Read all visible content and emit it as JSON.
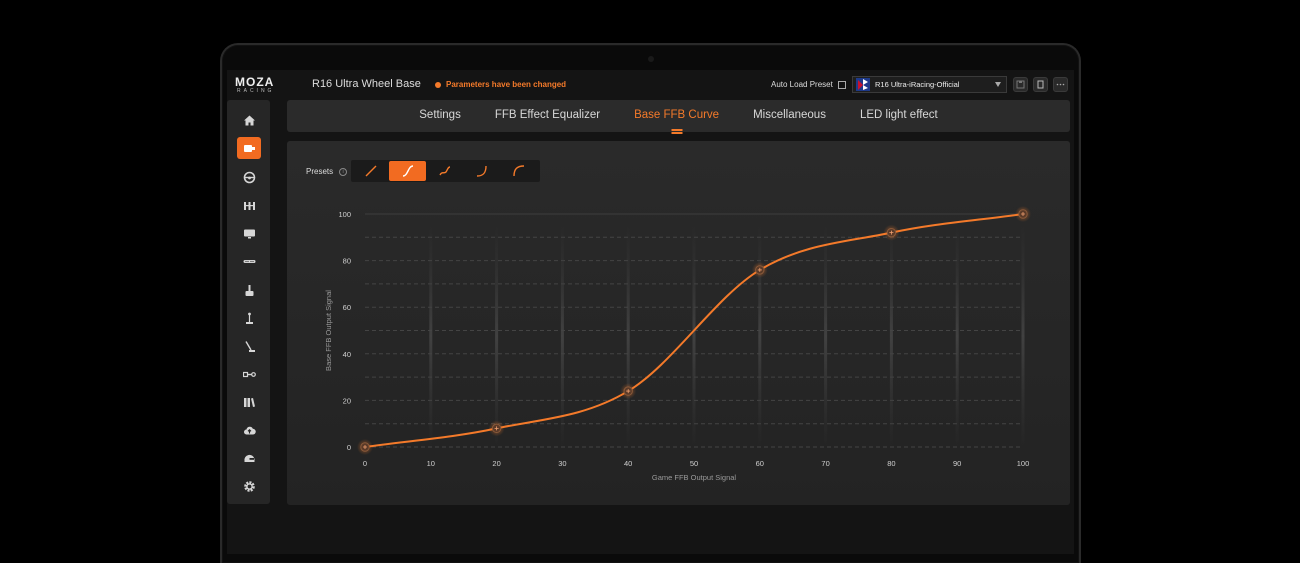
{
  "app": {
    "logo_main": "MOZA",
    "logo_sub": "RACING",
    "device_name": "R16 Ultra Wheel Base",
    "status_message": "Parameters have been changed",
    "auto_load_label": "Auto Load Preset",
    "selected_preset": "R16 Ultra-iRacing-Official"
  },
  "colors": {
    "accent": "#f26b21",
    "curve": "#f47a2a",
    "background": "#141414",
    "panel": "#2a2a2a"
  },
  "sidebar": {
    "items": [
      {
        "icon": "home-icon",
        "active": false
      },
      {
        "icon": "wheelbase-icon",
        "active": true
      },
      {
        "icon": "steering-wheel-icon",
        "active": false
      },
      {
        "icon": "pedals-icon",
        "active": false
      },
      {
        "icon": "dashboard-icon",
        "active": false
      },
      {
        "icon": "display-bar-icon",
        "active": false
      },
      {
        "icon": "handbrake-icon",
        "active": false
      },
      {
        "icon": "shifter-icon",
        "active": false
      },
      {
        "icon": "sequential-shifter-icon",
        "active": false
      },
      {
        "icon": "hub-icon",
        "active": false
      },
      {
        "icon": "library-icon",
        "active": false
      },
      {
        "icon": "cloud-upload-icon",
        "active": false
      },
      {
        "icon": "helmet-icon",
        "active": false
      },
      {
        "icon": "settings-gear-icon",
        "active": false
      }
    ]
  },
  "tabs": [
    {
      "label": "Settings",
      "active": false
    },
    {
      "label": "FFB Effect Equalizer",
      "active": false
    },
    {
      "label": "Base FFB Curve",
      "active": true
    },
    {
      "label": "Miscellaneous",
      "active": false
    },
    {
      "label": "LED light effect",
      "active": false
    }
  ],
  "presets": {
    "label": "Presets",
    "info_glyph": "i",
    "items": [
      {
        "icon": "linear-curve-icon",
        "active": false
      },
      {
        "icon": "s-curve-icon",
        "active": true
      },
      {
        "icon": "wave-curve-icon",
        "active": false
      },
      {
        "icon": "late-rise-curve-icon",
        "active": false
      },
      {
        "icon": "early-rise-curve-icon",
        "active": false
      }
    ]
  },
  "chart_data": {
    "type": "line",
    "xlabel": "Game FFB Output Signal",
    "ylabel": "Base FFB Output Signal",
    "xlim": [
      0,
      100
    ],
    "ylim": [
      0,
      100
    ],
    "xticks": [
      0,
      10,
      20,
      30,
      40,
      50,
      60,
      70,
      80,
      90,
      100
    ],
    "yticks": [
      0,
      20,
      40,
      60,
      80,
      100
    ],
    "grid": true,
    "series": [
      {
        "control_points": [
          {
            "x": 0,
            "y": 0
          },
          {
            "x": 20,
            "y": 8
          },
          {
            "x": 40,
            "y": 24
          },
          {
            "x": 60,
            "y": 76
          },
          {
            "x": 80,
            "y": 92
          },
          {
            "x": 100,
            "y": 100
          }
        ]
      }
    ]
  }
}
